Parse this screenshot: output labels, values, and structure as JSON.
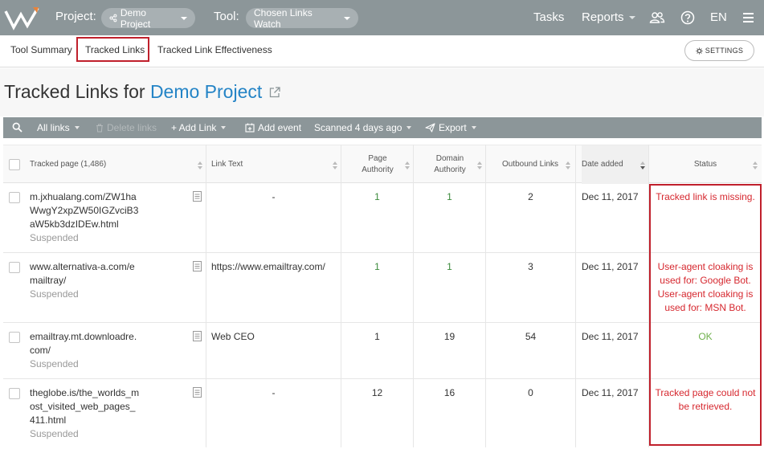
{
  "topbar": {
    "project_label": "Project:",
    "project_value": "Demo Project",
    "tool_label": "Tool:",
    "tool_value": "Chosen Links Watch",
    "tasks": "Tasks",
    "reports": "Reports",
    "language": "EN"
  },
  "tabs": {
    "summary": "Tool Summary",
    "tracked": "Tracked Links",
    "effectiveness": "Tracked Link Effectiveness",
    "settings": "SETTINGS"
  },
  "heading": {
    "prefix": "Tracked Links for",
    "project": "Demo Project"
  },
  "toolbar": {
    "all_links": "All links",
    "delete": "Delete links",
    "add_link": "+ Add Link",
    "add_event": "Add event",
    "scanned": "Scanned 4 days ago",
    "export": "Export"
  },
  "columns": {
    "tracked_page": "Tracked page (1,486)",
    "link_text": "Link Text",
    "page_authority": "Page Authority",
    "domain_authority": "Domain Authority",
    "outbound": "Outbound Links",
    "date_added": "Date added",
    "status": "Status"
  },
  "rows": [
    {
      "url": "m.jxhualang.com/ZW1haWwgY2xpZW50IGZvciB3aW5kb3dzIDEw.html",
      "state": "Suspended",
      "link_text": "-",
      "pa": "1",
      "da": "1",
      "outbound": "2",
      "date": "Dec 11, 2017",
      "status": "Tracked link is missing."
    },
    {
      "url": "www.alternativa-a.com/emailtray/",
      "state": "Suspended",
      "link_text": "https://www.emailtray.com/",
      "pa": "1",
      "da": "1",
      "outbound": "3",
      "date": "Dec 11, 2017",
      "status": "User-agent cloaking is used for: Google Bot. User-agent cloaking is used for: MSN Bot."
    },
    {
      "url": "emailtray.mt.downloadre.com/",
      "state": "Suspended",
      "link_text": "Web CEO",
      "pa": "1",
      "da": "19",
      "outbound": "54",
      "date": "Dec 11, 2017",
      "status": "OK"
    },
    {
      "url": "theglobe.is/the_worlds_most_visited_web_pages_411.html",
      "state": "Suspended",
      "link_text": "-",
      "pa": "12",
      "da": "16",
      "outbound": "0",
      "date": "Dec 11, 2017",
      "status": "Tracked page could not be retrieved."
    }
  ],
  "colors": {
    "topbar": "#8c9699",
    "link_blue": "#2484c6",
    "status_red": "#d6282f",
    "status_ok": "#6fb04c",
    "highlight": "#c0202c"
  }
}
